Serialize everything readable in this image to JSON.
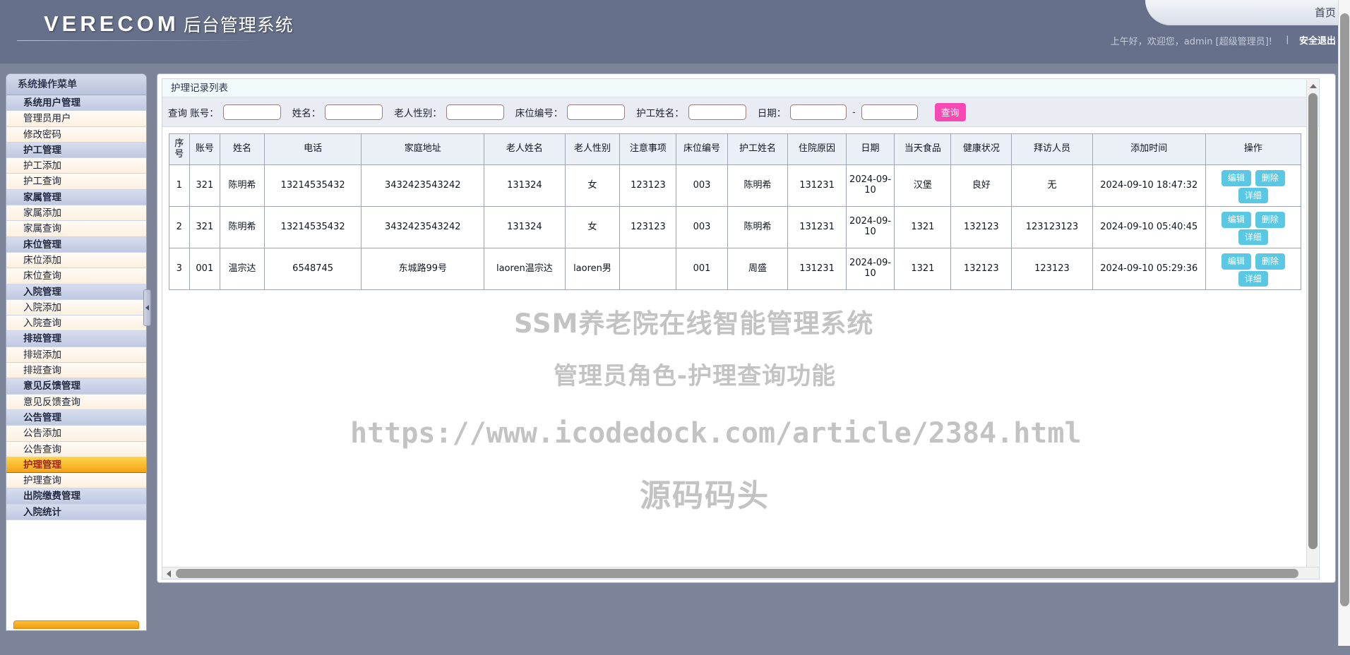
{
  "header": {
    "brand_en": "VERECOM",
    "brand_cn": "后台管理系统",
    "nav_tab": "首页",
    "welcome": "上午好，欢迎您，admin [超级管理员]!",
    "separator": "|",
    "logout": "安全退出"
  },
  "sidebar": {
    "title": "系统操作菜单",
    "items": [
      {
        "label": "系统用户管理",
        "type": "group",
        "active": false
      },
      {
        "label": "管理员用户",
        "type": "leaf",
        "active": false
      },
      {
        "label": "修改密码",
        "type": "leaf",
        "active": false
      },
      {
        "label": "护工管理",
        "type": "group",
        "active": false
      },
      {
        "label": "护工添加",
        "type": "leaf",
        "active": false
      },
      {
        "label": "护工查询",
        "type": "leaf",
        "active": false
      },
      {
        "label": "家属管理",
        "type": "group",
        "active": false
      },
      {
        "label": "家属添加",
        "type": "leaf",
        "active": false
      },
      {
        "label": "家属查询",
        "type": "leaf",
        "active": false
      },
      {
        "label": "床位管理",
        "type": "group",
        "active": false
      },
      {
        "label": "床位添加",
        "type": "leaf",
        "active": false
      },
      {
        "label": "床位查询",
        "type": "leaf",
        "active": false
      },
      {
        "label": "入院管理",
        "type": "group",
        "active": false
      },
      {
        "label": "入院添加",
        "type": "leaf",
        "active": false
      },
      {
        "label": "入院查询",
        "type": "leaf",
        "active": false
      },
      {
        "label": "排班管理",
        "type": "group",
        "active": false
      },
      {
        "label": "排班添加",
        "type": "leaf",
        "active": false
      },
      {
        "label": "排班查询",
        "type": "leaf",
        "active": false
      },
      {
        "label": "意见反馈管理",
        "type": "group",
        "active": false
      },
      {
        "label": "意见反馈查询",
        "type": "leaf",
        "active": false
      },
      {
        "label": "公告管理",
        "type": "group",
        "active": false
      },
      {
        "label": "公告添加",
        "type": "leaf",
        "active": false
      },
      {
        "label": "公告查询",
        "type": "leaf",
        "active": false
      },
      {
        "label": "护理管理",
        "type": "group",
        "active": true
      },
      {
        "label": "护理查询",
        "type": "leaf",
        "active": false
      },
      {
        "label": "出院缴费管理",
        "type": "group",
        "active": false
      },
      {
        "label": "入院统计",
        "type": "group",
        "active": false
      }
    ]
  },
  "panel": {
    "caption": "护理记录列表"
  },
  "filters": {
    "fields": [
      {
        "label": "查询 账号：",
        "value": ""
      },
      {
        "label": "姓名：",
        "value": ""
      },
      {
        "label": "老人性别：",
        "value": ""
      },
      {
        "label": "床位编号：",
        "value": ""
      },
      {
        "label": "护工姓名：",
        "value": ""
      }
    ],
    "date_label": "日期：",
    "date_from": "",
    "date_to": "",
    "date_separator": "-",
    "query_button": "查询"
  },
  "table": {
    "headers": [
      "序号",
      "账号",
      "姓名",
      "电话",
      "家庭地址",
      "老人姓名",
      "老人性别",
      "注意事项",
      "床位编号",
      "护工姓名",
      "住院原因",
      "日期",
      "当天食品",
      "健康状况",
      "拜访人员",
      "添加时间",
      "操作"
    ],
    "rows": [
      {
        "index": "1",
        "account": "321",
        "name": "陈明希",
        "phone": "13214535432",
        "address": "3432423543242",
        "elder_name": "131324",
        "elder_gender": "女",
        "notes": "123123",
        "bed_no": "003",
        "nurse_name": "陈明希",
        "admit_reason": "131231",
        "date": "2024-09-10",
        "food": "汉堡",
        "health": "良好",
        "visitor": "无",
        "added_time": "2024-09-10 18:47:32"
      },
      {
        "index": "2",
        "account": "321",
        "name": "陈明希",
        "phone": "13214535432",
        "address": "3432423543242",
        "elder_name": "131324",
        "elder_gender": "女",
        "notes": "123123",
        "bed_no": "003",
        "nurse_name": "陈明希",
        "admit_reason": "131231",
        "date": "2024-09-10",
        "food": "1321",
        "health": "132123",
        "visitor": "123123123",
        "added_time": "2024-09-10 05:40:45"
      },
      {
        "index": "3",
        "account": "001",
        "name": "温宗达",
        "phone": "6548745",
        "address": "东城路99号",
        "elder_name": "laoren温宗达",
        "elder_gender": "laoren男",
        "notes": "",
        "bed_no": "001",
        "nurse_name": "周盛",
        "admit_reason": "131231",
        "date": "2024-09-10",
        "food": "1321",
        "health": "132123",
        "visitor": "123123",
        "added_time": "2024-09-10 05:29:36"
      }
    ],
    "actions": {
      "edit": "编辑",
      "delete": "删除",
      "detail": "详细"
    }
  },
  "watermark": {
    "line1": "SSM养老院在线智能管理系统",
    "line2": "管理员角色-护理查询功能",
    "url": "https://www.icodedock.com/article/2384.html",
    "footer": "源码码头"
  },
  "colors": {
    "header_bg": "#66708a",
    "body_bg": "#7b8499",
    "accent_pink": "#f848b4",
    "accent_cyan": "#5bc8e3",
    "active_orange": "#f5a315",
    "active_text": "#a32200"
  }
}
